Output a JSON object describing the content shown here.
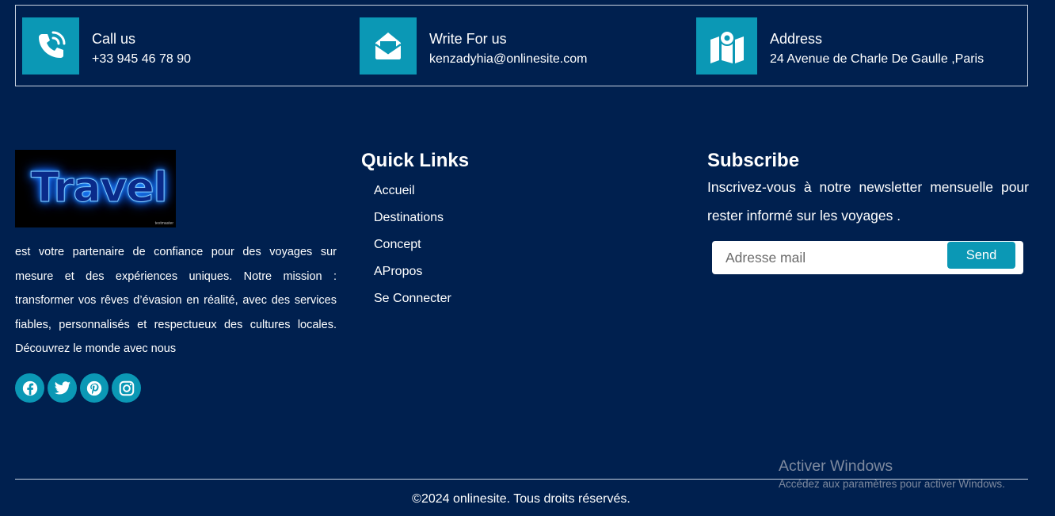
{
  "contact": [
    {
      "icon": "phone-icon",
      "title": "Call us",
      "value": "+33 945 46 78 90"
    },
    {
      "icon": "envelope-icon",
      "title": "Write For us",
      "value": "kenzadyhia@onlinesite.com"
    },
    {
      "icon": "map-icon",
      "title": "Address",
      "value": "24 Avenue de Charle De Gaulle ,Paris"
    }
  ],
  "brand": {
    "logo_text": "Travel",
    "logo_small": "textmaster"
  },
  "about": "est votre partenaire de confiance pour des voyages sur mesure et des expériences uniques. Notre mission : transformer vos rêves d’évasion en réalité, avec des services fiables, personnalisés et respectueux des cultures locales. Découvrez le monde avec nous",
  "socials": [
    "facebook-icon",
    "twitter-icon",
    "pinterest-icon",
    "instagram-icon"
  ],
  "quick_links": {
    "title": "Quick Links",
    "items": [
      "Accueil",
      "Destinations",
      "Concept",
      "APropos",
      "Se Connecter"
    ]
  },
  "subscribe": {
    "title": "Subscribe",
    "text": "Inscrivez-vous à notre newsletter mensuelle pour rester informé sur les voyages .",
    "placeholder": "Adresse mail",
    "button": "Send"
  },
  "copyright": "©2024 onlinesite. Tous droits réservés.",
  "windows": {
    "title": "Activer Windows",
    "subtitle": "Accédez aux paramètres pour activer Windows."
  },
  "colors": {
    "background": "#00204f",
    "accent": "#0b98b5",
    "text": "#ffffff"
  }
}
